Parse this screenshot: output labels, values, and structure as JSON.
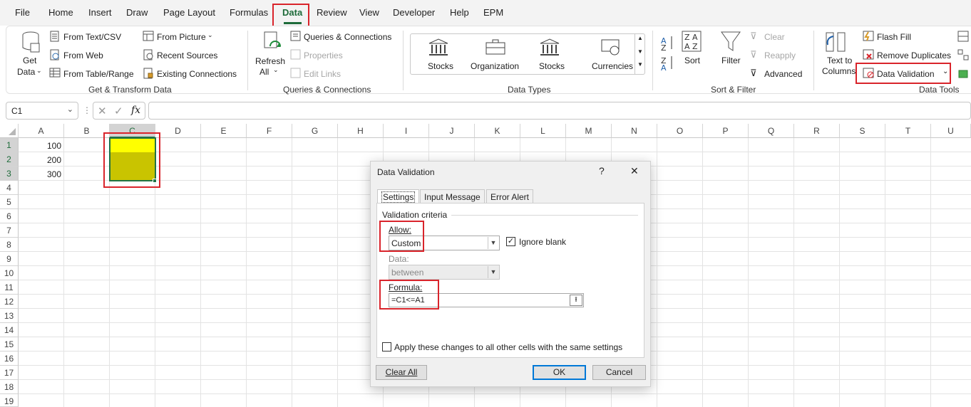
{
  "menubar": {
    "items": [
      "File",
      "Home",
      "Insert",
      "Draw",
      "Page Layout",
      "Formulas",
      "Data",
      "Review",
      "View",
      "Developer",
      "Help",
      "EPM"
    ]
  },
  "ribbon": {
    "get_transform": {
      "get_data": "Get",
      "get_data2": "Data",
      "from_text_csv": "From Text/CSV",
      "from_web": "From Web",
      "from_table_range": "From Table/Range",
      "from_picture": "From Picture",
      "recent_sources": "Recent Sources",
      "existing_connections": "Existing Connections",
      "label": "Get & Transform Data"
    },
    "queries": {
      "refresh": "Refresh",
      "refresh2": "All",
      "queries_connections": "Queries & Connections",
      "properties": "Properties",
      "edit_links": "Edit Links",
      "label": "Queries & Connections"
    },
    "data_types": {
      "items": [
        "Stocks",
        "Organization",
        "Stocks",
        "Currencies"
      ],
      "label": "Data Types"
    },
    "sort_filter": {
      "sort": "Sort",
      "filter": "Filter",
      "clear": "Clear",
      "reapply": "Reapply",
      "advanced": "Advanced",
      "label": "Sort & Filter"
    },
    "data_tools": {
      "text_to": "Text to",
      "columns": "Columns",
      "flash_fill": "Flash Fill",
      "remove_duplicates": "Remove Duplicates",
      "data_validation": "Data Validation",
      "label": "Data Tools"
    }
  },
  "formula_bar": {
    "name_box": "C1",
    "fx": "fx",
    "formula": ""
  },
  "grid": {
    "columns": [
      "A",
      "B",
      "C",
      "D",
      "E",
      "F",
      "G",
      "H",
      "I",
      "J",
      "K",
      "L",
      "M",
      "N",
      "O",
      "P",
      "Q",
      "R",
      "S",
      "T",
      "U"
    ],
    "rows": [
      "1",
      "2",
      "3",
      "4",
      "5",
      "6",
      "7",
      "8",
      "9",
      "10",
      "11",
      "12",
      "13",
      "14",
      "15",
      "16",
      "17",
      "18",
      "19"
    ],
    "cells": {
      "A1": "100",
      "A2": "200",
      "A3": "300"
    },
    "colors": {
      "c1_fill": "#ffff00",
      "c2_c3_fill": "#c9c400",
      "selection_border": "#217346"
    }
  },
  "dialog": {
    "title": "Data Validation",
    "help": "?",
    "close": "✕",
    "tabs": [
      "Settings",
      "Input Message",
      "Error Alert"
    ],
    "section": "Validation criteria",
    "allow_label": "Allow:",
    "allow_value": "Custom",
    "ignore_blank": "Ignore blank",
    "data_label": "Data:",
    "data_value": "between",
    "formula_label": "Formula:",
    "formula_value": "=C1<=A1",
    "apply_all": "Apply these changes to all other cells with the same settings",
    "clear_all": "Clear All",
    "ok": "OK",
    "cancel": "Cancel"
  },
  "highlight_color": "#d9242b"
}
